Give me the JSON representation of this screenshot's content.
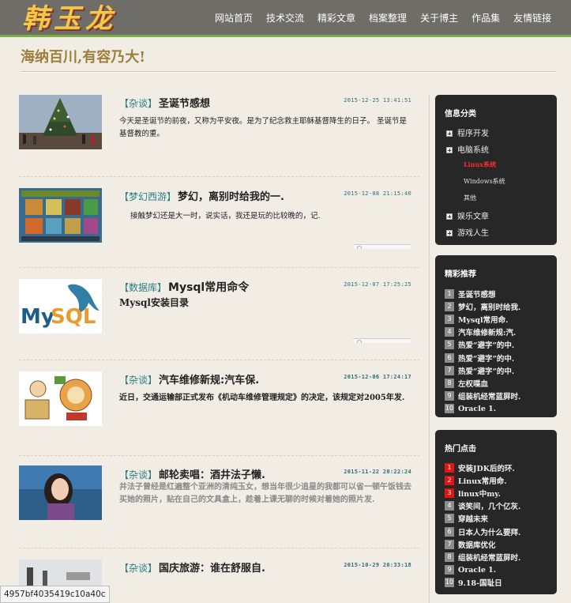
{
  "header": {
    "logo_text": "韩玉龙",
    "nav": [
      "网站首页",
      "技术交流",
      "精彩文章",
      "档案整理",
      "关于博主",
      "作品集",
      "友情链接"
    ]
  },
  "slogan": "海纳百川,有容乃大!",
  "articles": [
    {
      "category": "【杂谈】",
      "title": "圣诞节感想",
      "date": "2015-12-25 13:41:51",
      "excerpt": "今天是圣诞节的前夜，又称为平安夜。是为了纪念救主耶稣基督降生的日子。 圣诞节是基督教的重。",
      "thumb_icon": "christmas-tree-photo"
    },
    {
      "category": "【梦幻西游】",
      "title": "梦幻，离别时给我的一.",
      "date": "2015-12-08 21:15:40",
      "excerpt": "接触梦幻还是大一时，说实话，我还是玩的比较晚的，记.",
      "thumb_icon": "game-screenshot"
    },
    {
      "category": "【数据库】",
      "title": "Mysql常用命令",
      "date": "2015-12-07 17:25:25",
      "excerpt": "Mysql安装目录",
      "thumb_icon": "mysql-logo"
    },
    {
      "category": "【杂谈】",
      "title": "汽车维修新规:汽车保.",
      "date": "2015-12-06 17:24:17",
      "excerpt": "近日，交通运输部正式发布《机动车维修管理规定》的决定，该规定对2005年发.",
      "thumb_icon": "cartoon-illustration"
    },
    {
      "category": "【杂谈】",
      "title": "邮轮卖唱：酒井法子懒.",
      "date": "2015-11-22 20:22:24",
      "excerpt": "井法子曾经是红遍整个亚洲的清纯玉女，想当年很少追星的我都可以省一顿午饭钱去买她的照片，贴在自己的文具盒上，趁着上课无聊的时候对着她的照片发.",
      "thumb_icon": "portrait-photo"
    },
    {
      "category": "【杂谈】",
      "title": "国庆旅游：谁在舒服自.",
      "date": "2015-10-29 20:33:18",
      "excerpt": "",
      "thumb_icon": "street-photo"
    }
  ],
  "sidebar": {
    "categories_title": "信息分类",
    "categories": [
      {
        "label": "程序开发"
      },
      {
        "label": "电脑系统"
      },
      {
        "label": "Linux系统",
        "sub": true,
        "active": true
      },
      {
        "label": "Windows系统",
        "sub": true
      },
      {
        "label": "其他",
        "sub": true
      },
      {
        "label": "娱乐文章"
      },
      {
        "label": "游戏人生"
      }
    ],
    "recommend_title": "精彩推荐",
    "recommend": [
      "圣诞节感想",
      "梦幻，离别时给我.",
      "Mysql常用命.",
      "汽车维修新规:汽.",
      "热爱“避字”的中.",
      "热爱“避字”的中.",
      "热爱“避字”的中.",
      "左权喋血",
      "组装机经常蓝屏时.",
      "Oracle 1."
    ],
    "hot_title": "热门点击",
    "hot": [
      "安装JDK后的环.",
      "Linux常用命.",
      "linux中my.",
      "谈笑间，几个亿灰.",
      "穿越未来",
      "日本人为什么要拜.",
      "数据库优化",
      "组装机经常蓝屏时.",
      "Oracle 1.",
      "9.18-国耻日"
    ],
    "hot_highlight_count": 3
  },
  "status_url": "4957bf4035419c10a40c",
  "colors": {
    "accent_green": "#7cae43",
    "hot_red": "#e31414",
    "category_teal": "#2a7e84"
  }
}
